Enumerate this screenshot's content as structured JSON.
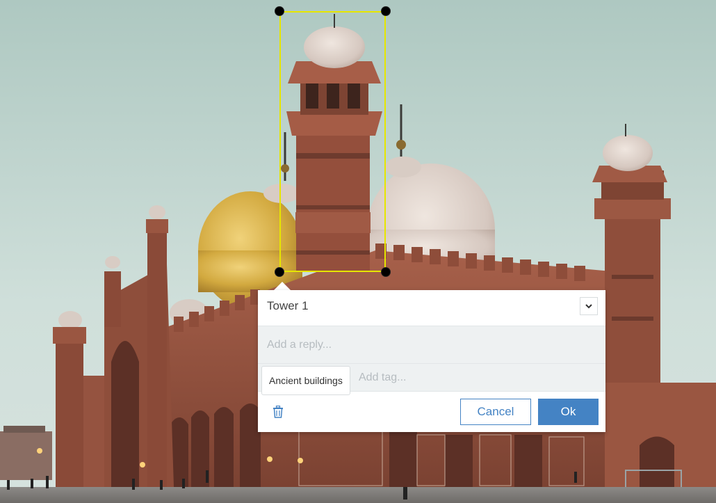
{
  "annotation": {
    "comment": "Tower 1",
    "reply_placeholder": "Add a reply...",
    "tags": [
      "Ancient buildings"
    ],
    "tag_placeholder": "Add tag...",
    "cancel_label": "Cancel",
    "ok_label": "Ok"
  },
  "icons": {
    "dropdown": "chevron-down-icon",
    "delete": "trash-icon"
  },
  "colors": {
    "selection_border": "#e6e600",
    "handle": "#000000",
    "primary": "#4483c4"
  }
}
